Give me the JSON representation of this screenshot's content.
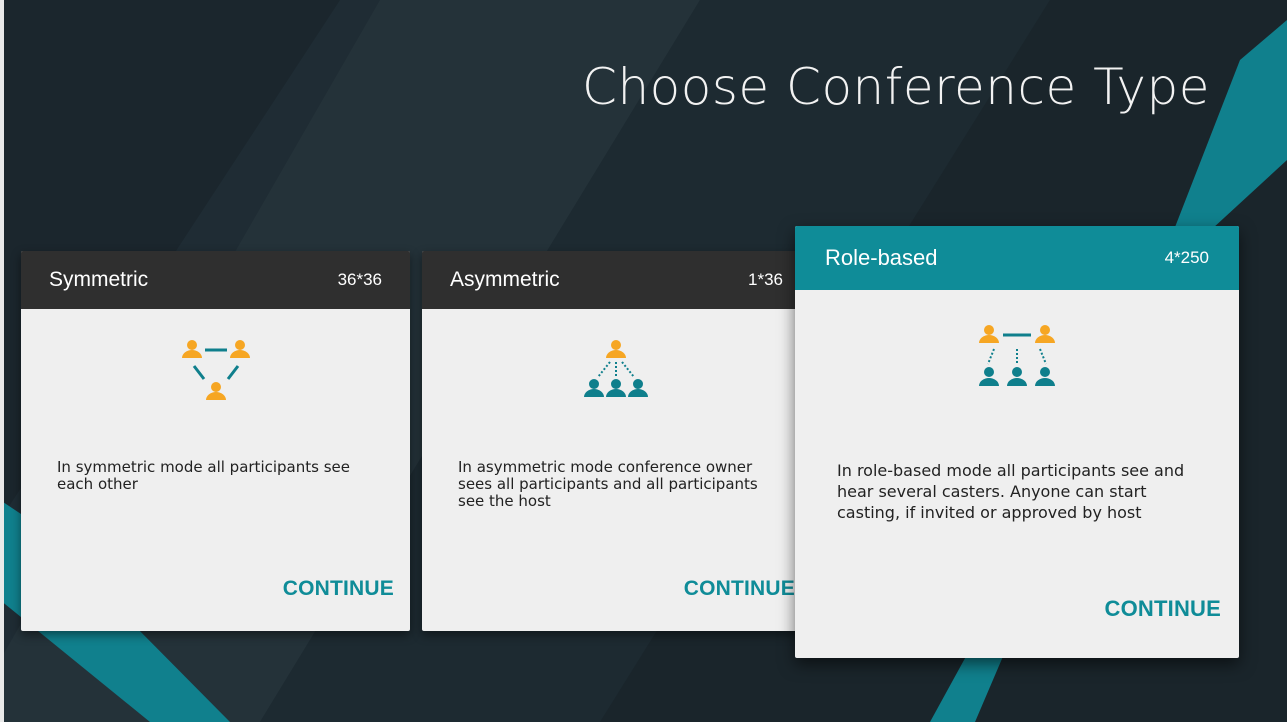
{
  "title": "Choose Conference Type",
  "colors": {
    "accent": "#0f8c98",
    "person_orange": "#f6a623",
    "person_teal": "#0f7f8c"
  },
  "cards": [
    {
      "title": "Symmetric",
      "count": "36*36",
      "icon": "symmetric-conference-icon",
      "description": "In symmetric mode all participants see each other",
      "action": "CONTINUE"
    },
    {
      "title": "Asymmetric",
      "count": "1*36",
      "icon": "asymmetric-conference-icon",
      "description": "In asymmetric mode conference owner sees all participants and all participants see the host",
      "action": "CONTINUE"
    },
    {
      "title": "Role-based",
      "count": "4*250",
      "icon": "role-based-conference-icon",
      "description": "In role-based mode all participants see and hear several casters. Anyone can start casting, if invited or approved by host",
      "action": "CONTINUE"
    }
  ]
}
